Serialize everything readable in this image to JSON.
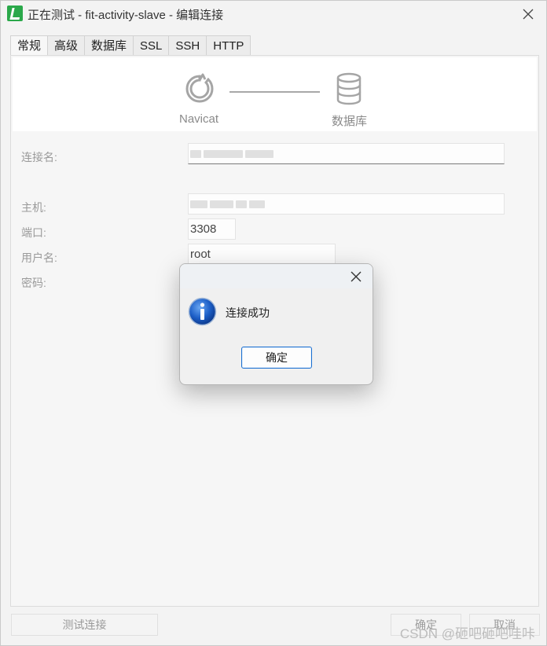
{
  "window": {
    "title": "正在测试 - fit-activity-slave - 编辑连接"
  },
  "tabs": [
    {
      "label": "常规"
    },
    {
      "label": "高级"
    },
    {
      "label": "数据库"
    },
    {
      "label": "SSL"
    },
    {
      "label": "SSH"
    },
    {
      "label": "HTTP"
    }
  ],
  "banner": {
    "left_label": "Navicat",
    "right_label": "数据库"
  },
  "form": {
    "connection_name_label": "连接名:",
    "host_label": "主机:",
    "port_label": "端口:",
    "port_value": "3308",
    "username_label": "用户名:",
    "username_value": "root",
    "password_label": "密码:"
  },
  "buttons": {
    "test_connection": "测试连接",
    "ok": "确定",
    "cancel": "取消"
  },
  "dialog": {
    "message": "连接成功",
    "ok_label": "确定"
  },
  "watermark": "CSDN @砸吧砸吧哇咔",
  "colors": {
    "logo": "#2aa84a",
    "dialog_button_border": "#1a6fd1",
    "info_icon": "#1d5fc7"
  }
}
